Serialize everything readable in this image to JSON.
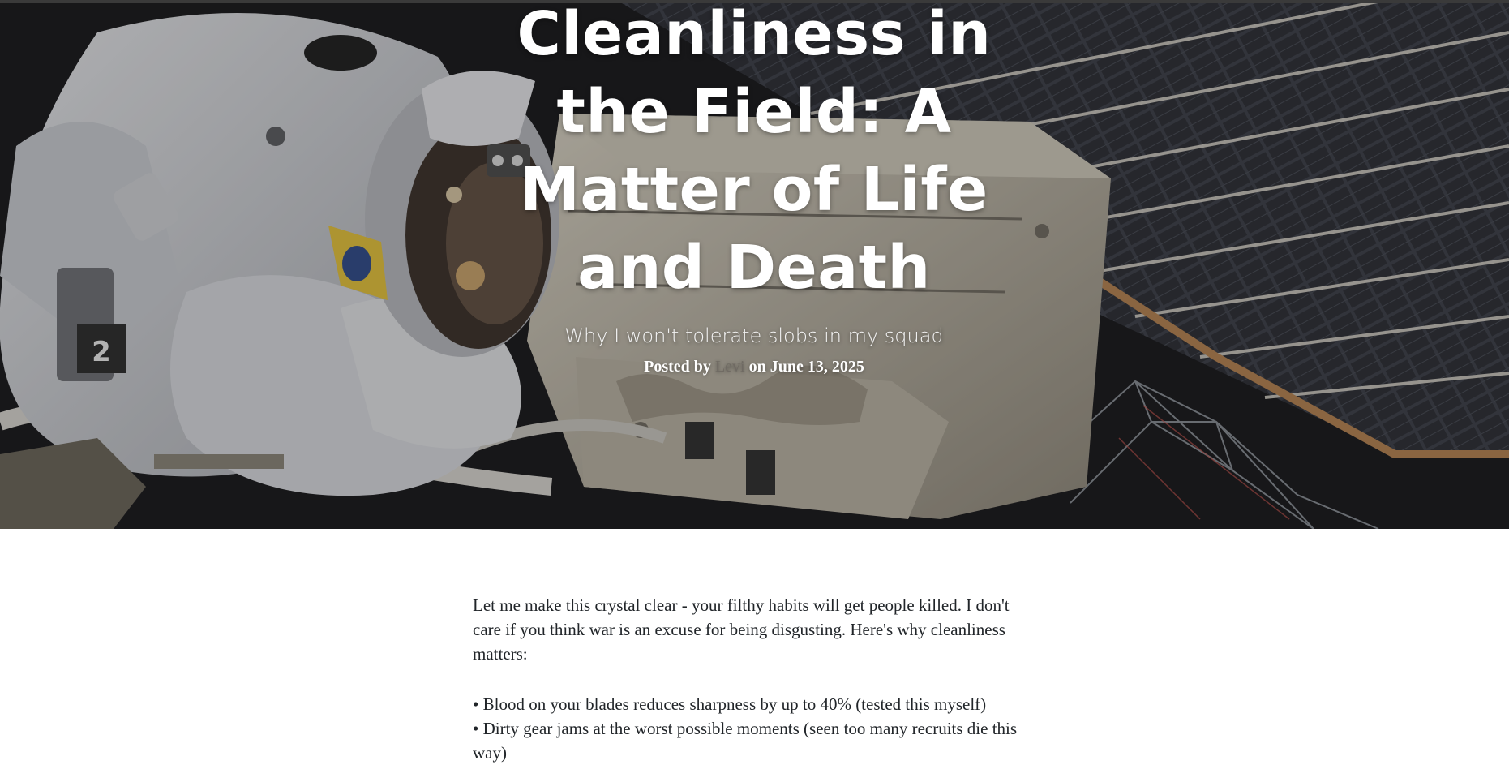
{
  "post": {
    "title": "Cleanliness in the Field: A Matter of Life and Death",
    "subtitle": "Why I won't tolerate slobs in my squad",
    "meta_prefix": "Posted by",
    "author": "Levi",
    "meta_suffix": "on June 13, 2025",
    "intro": "Let me make this crystal clear - your filthy habits will get people killed. I don't care if you think war is an excuse for being disgusting. Here's why cleanliness matters:",
    "bullets": [
      "• Blood on your blades reduces sharpness by up to 40% (tested this myself)",
      "• Dirty gear jams at the worst possible moments (seen too many recruits die this way)"
    ]
  },
  "hero_image": {
    "subject": "astronaut-spacewalk-with-solar-panels",
    "sticker_number": "2"
  },
  "colors": {
    "overlay": "#1e1e1e",
    "title": "#ffffff",
    "author_link": "#6f6a63",
    "body_text": "#212529"
  }
}
